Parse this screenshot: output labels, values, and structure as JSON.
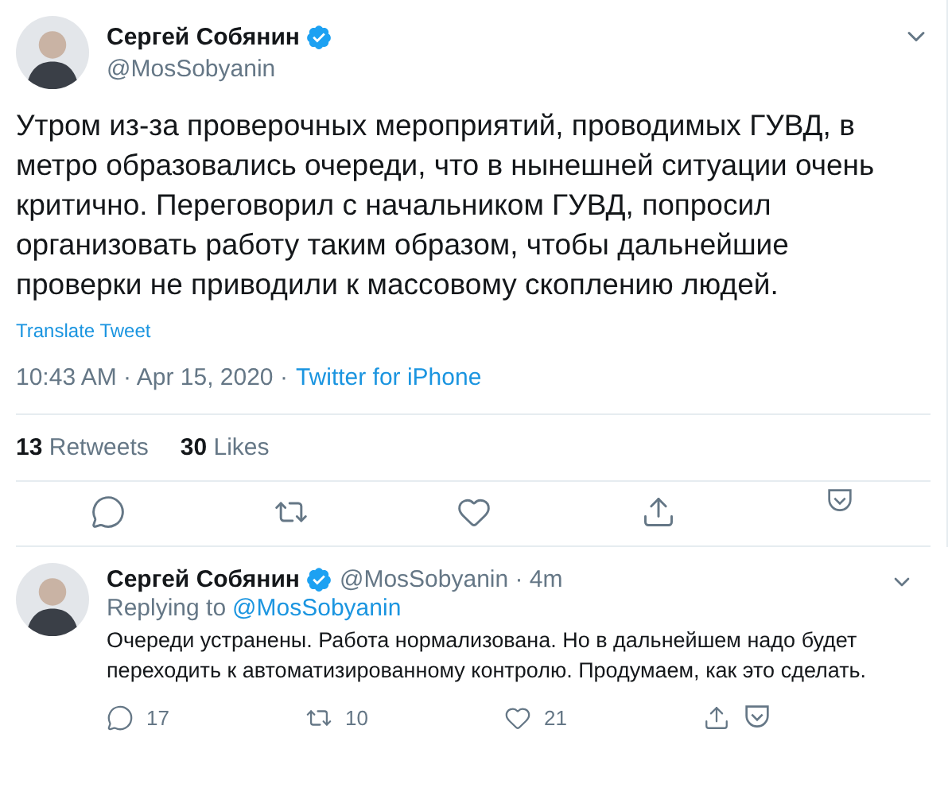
{
  "tweet": {
    "author": "Сергей Собянин",
    "verified": true,
    "handle": "@MosSobyanin",
    "text": "Утром из-за проверочных мероприятий, проводимых ГУВД, в метро образовались очереди, что в нынешней ситуации очень критично. Переговорил с начальником ГУВД, попросил организовать работу таким образом, чтобы дальнейшие проверки не приводили к массовому скоплению людей.",
    "translate": "Translate Tweet",
    "time": "10:43 AM · Apr 15, 2020 ·",
    "source": "Twitter for iPhone",
    "stats": [
      {
        "count": "13",
        "label": "Retweets"
      },
      {
        "count": "30",
        "label": "Likes"
      }
    ]
  },
  "reply": {
    "author": "Сергей Собянин",
    "verified": true,
    "handle": "@MosSobyanin · 4m",
    "replying_label": "Replying to",
    "replying_to": "@MosSobyanin",
    "text": "Очереди устранены. Работа нормализована. Но в дальнейшем надо будет переходить к автоматизированному контролю. Продумаем, как это сделать.",
    "actions": [
      {
        "kind": "reply",
        "count": "17"
      },
      {
        "kind": "retweet",
        "count": "10"
      },
      {
        "kind": "like",
        "count": "21"
      },
      {
        "kind": "share"
      },
      {
        "kind": "pocket"
      }
    ]
  }
}
